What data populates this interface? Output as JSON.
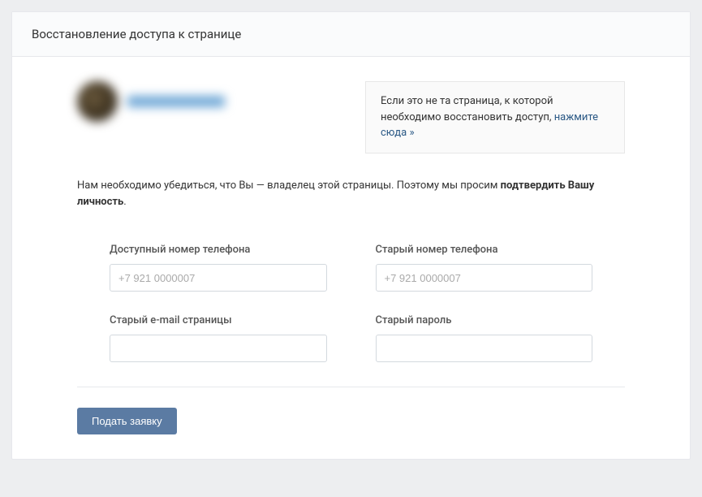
{
  "header": {
    "title": "Восстановление доступа к странице"
  },
  "info": {
    "text_before": "Если это не та страница, к которой необходимо восстановить доступ, ",
    "link": "нажмите сюда »"
  },
  "instruction": {
    "text_before": "Нам необходимо убедиться, что Вы — владелец этой страницы. Поэтому мы просим ",
    "bold": "подтвердить Вашу личность",
    "text_after": "."
  },
  "form": {
    "available_phone": {
      "label": "Доступный номер телефона",
      "placeholder": "+7 921 0000007"
    },
    "old_phone": {
      "label": "Старый номер телефона",
      "placeholder": "+7 921 0000007"
    },
    "old_email": {
      "label": "Старый e-mail страницы"
    },
    "old_password": {
      "label": "Старый пароль"
    }
  },
  "submit": {
    "label": "Подать заявку"
  }
}
